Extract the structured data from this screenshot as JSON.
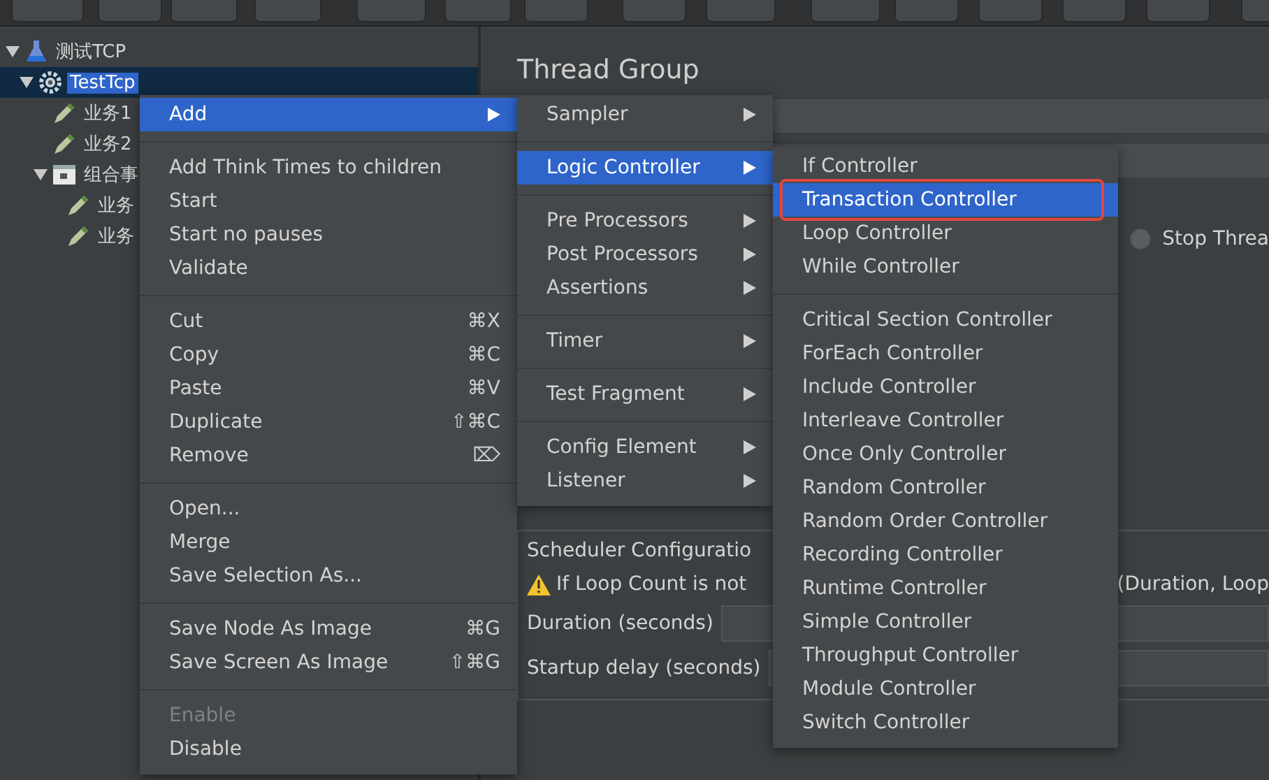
{
  "tree": [
    {
      "label": "测试TCP",
      "kind": "test-plan",
      "expanded": true,
      "selected": false,
      "children": [
        {
          "label": "TestTcp",
          "kind": "thread-group",
          "expanded": true,
          "selected": true,
          "children": [
            {
              "label": "业务1",
              "kind": "sampler",
              "selected": false
            },
            {
              "label": "业务2",
              "kind": "sampler",
              "selected": false
            },
            {
              "label": "组合事",
              "kind": "controller",
              "expanded": true,
              "selected": false,
              "children": [
                {
                  "label": "业务",
                  "kind": "sampler",
                  "selected": false
                },
                {
                  "label": "业务",
                  "kind": "sampler",
                  "selected": false
                }
              ]
            }
          ]
        }
      ]
    }
  ],
  "panel": {
    "title": "Thread Group",
    "radio_label": "Stop Threa",
    "radio_selected": false,
    "scheduler": {
      "heading": "Scheduler Configuratio",
      "warning": "If Loop Count is not",
      "warning_tail": "(Duration, Loop",
      "duration_label": "Duration (seconds)",
      "delay_label": "Startup delay (seconds)"
    }
  },
  "menus": [
    {
      "items": [
        {
          "kind": "item",
          "label": "Add",
          "submenu": true,
          "selected": true,
          "disabled": false
        },
        {
          "kind": "separator"
        },
        {
          "kind": "item",
          "label": "Add Think Times to children",
          "submenu": false,
          "selected": false,
          "disabled": false
        },
        {
          "kind": "item",
          "label": "Start",
          "submenu": false,
          "selected": false,
          "disabled": false
        },
        {
          "kind": "item",
          "label": "Start no pauses",
          "submenu": false,
          "selected": false,
          "disabled": false
        },
        {
          "kind": "item",
          "label": "Validate",
          "submenu": false,
          "selected": false,
          "disabled": false
        },
        {
          "kind": "separator"
        },
        {
          "kind": "item",
          "label": "Cut",
          "shortcut": "⌘X",
          "submenu": false,
          "selected": false,
          "disabled": false
        },
        {
          "kind": "item",
          "label": "Copy",
          "shortcut": "⌘C",
          "submenu": false,
          "selected": false,
          "disabled": false
        },
        {
          "kind": "item",
          "label": "Paste",
          "shortcut": "⌘V",
          "submenu": false,
          "selected": false,
          "disabled": false
        },
        {
          "kind": "item",
          "label": "Duplicate",
          "shortcut": "⇧⌘C",
          "submenu": false,
          "selected": false,
          "disabled": false
        },
        {
          "kind": "item",
          "label": "Remove",
          "shortcut": "⌦",
          "submenu": false,
          "selected": false,
          "disabled": false
        },
        {
          "kind": "separator"
        },
        {
          "kind": "item",
          "label": "Open...",
          "submenu": false,
          "selected": false,
          "disabled": false
        },
        {
          "kind": "item",
          "label": "Merge",
          "submenu": false,
          "selected": false,
          "disabled": false
        },
        {
          "kind": "item",
          "label": "Save Selection As...",
          "submenu": false,
          "selected": false,
          "disabled": false
        },
        {
          "kind": "separator"
        },
        {
          "kind": "item",
          "label": "Save Node As Image",
          "shortcut": "⌘G",
          "submenu": false,
          "selected": false,
          "disabled": false
        },
        {
          "kind": "item",
          "label": "Save Screen As Image",
          "shortcut": "⇧⌘G",
          "submenu": false,
          "selected": false,
          "disabled": false
        },
        {
          "kind": "separator"
        },
        {
          "kind": "item",
          "label": "Enable",
          "submenu": false,
          "selected": false,
          "disabled": true
        },
        {
          "kind": "item",
          "label": "Disable",
          "submenu": false,
          "selected": false,
          "disabled": false
        }
      ]
    },
    {
      "items": [
        {
          "kind": "item",
          "label": "Sampler",
          "submenu": true,
          "selected": false,
          "disabled": false
        },
        {
          "kind": "separator"
        },
        {
          "kind": "item",
          "label": "Logic Controller",
          "submenu": true,
          "selected": true,
          "disabled": false
        },
        {
          "kind": "separator"
        },
        {
          "kind": "item",
          "label": "Pre Processors",
          "submenu": true,
          "selected": false,
          "disabled": false
        },
        {
          "kind": "item",
          "label": "Post Processors",
          "submenu": true,
          "selected": false,
          "disabled": false
        },
        {
          "kind": "item",
          "label": "Assertions",
          "submenu": true,
          "selected": false,
          "disabled": false
        },
        {
          "kind": "separator"
        },
        {
          "kind": "item",
          "label": "Timer",
          "submenu": true,
          "selected": false,
          "disabled": false
        },
        {
          "kind": "separator"
        },
        {
          "kind": "item",
          "label": "Test Fragment",
          "submenu": true,
          "selected": false,
          "disabled": false
        },
        {
          "kind": "separator"
        },
        {
          "kind": "item",
          "label": "Config Element",
          "submenu": true,
          "selected": false,
          "disabled": false
        },
        {
          "kind": "item",
          "label": "Listener",
          "submenu": true,
          "selected": false,
          "disabled": false
        }
      ]
    },
    {
      "items": [
        {
          "kind": "item",
          "label": "If Controller",
          "submenu": false,
          "selected": false,
          "disabled": false
        },
        {
          "kind": "item",
          "label": "Transaction Controller",
          "submenu": false,
          "selected": true,
          "disabled": false,
          "highlighted": true
        },
        {
          "kind": "item",
          "label": "Loop Controller",
          "submenu": false,
          "selected": false,
          "disabled": false
        },
        {
          "kind": "item",
          "label": "While Controller",
          "submenu": false,
          "selected": false,
          "disabled": false
        },
        {
          "kind": "separator"
        },
        {
          "kind": "item",
          "label": "Critical Section Controller",
          "submenu": false,
          "selected": false,
          "disabled": false
        },
        {
          "kind": "item",
          "label": "ForEach Controller",
          "submenu": false,
          "selected": false,
          "disabled": false
        },
        {
          "kind": "item",
          "label": "Include Controller",
          "submenu": false,
          "selected": false,
          "disabled": false
        },
        {
          "kind": "item",
          "label": "Interleave Controller",
          "submenu": false,
          "selected": false,
          "disabled": false
        },
        {
          "kind": "item",
          "label": "Once Only Controller",
          "submenu": false,
          "selected": false,
          "disabled": false
        },
        {
          "kind": "item",
          "label": "Random Controller",
          "submenu": false,
          "selected": false,
          "disabled": false
        },
        {
          "kind": "item",
          "label": "Random Order Controller",
          "submenu": false,
          "selected": false,
          "disabled": false
        },
        {
          "kind": "item",
          "label": "Recording Controller",
          "submenu": false,
          "selected": false,
          "disabled": false
        },
        {
          "kind": "item",
          "label": "Runtime Controller",
          "submenu": false,
          "selected": false,
          "disabled": false
        },
        {
          "kind": "item",
          "label": "Simple Controller",
          "submenu": false,
          "selected": false,
          "disabled": false
        },
        {
          "kind": "item",
          "label": "Throughput Controller",
          "submenu": false,
          "selected": false,
          "disabled": false
        },
        {
          "kind": "item",
          "label": "Module Controller",
          "submenu": false,
          "selected": false,
          "disabled": false
        },
        {
          "kind": "item",
          "label": "Switch Controller",
          "submenu": false,
          "selected": false,
          "disabled": false
        }
      ]
    }
  ]
}
